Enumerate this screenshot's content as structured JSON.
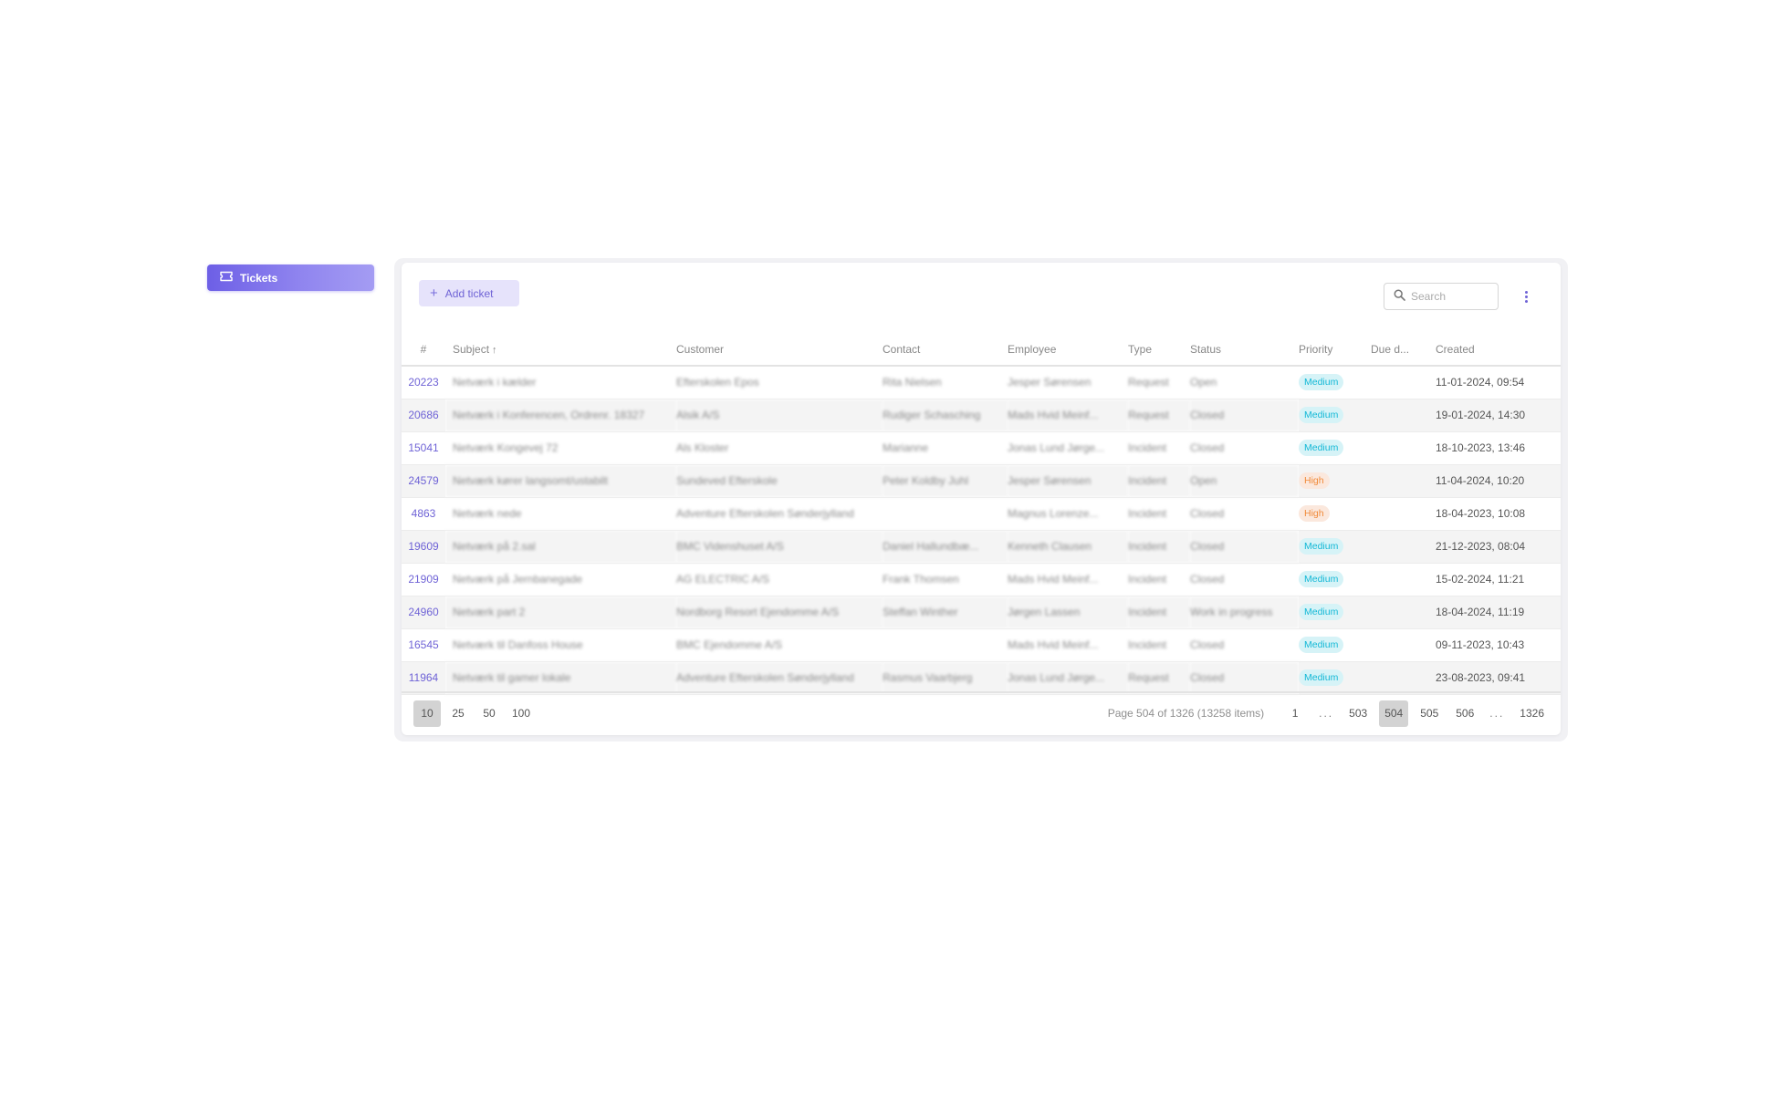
{
  "sidebar": {
    "items": [
      {
        "label": "Tickets",
        "icon": "ticket-icon",
        "active": true
      }
    ]
  },
  "toolbar": {
    "add_label": "Add ticket",
    "search_placeholder": "Search",
    "search_value": ""
  },
  "colors": {
    "accent": "#6f63d6",
    "medium_badge_bg": "#d6f3f7",
    "medium_badge_text": "#13b8d6",
    "high_badge_bg": "#fbe8dd",
    "high_badge_text": "#f08a3a"
  },
  "table": {
    "columns": [
      "#",
      "Subject",
      "Customer",
      "Contact",
      "Employee",
      "Type",
      "Status",
      "Priority",
      "Due d...",
      "Created"
    ],
    "sort": {
      "column": "Subject",
      "direction": "ascending"
    },
    "rows": [
      {
        "id": "20223",
        "subject": "Netværk i kælder",
        "customer": "Efterskolen Epos",
        "contact": "Rita Nielsen",
        "employee": "Jesper Sørensen",
        "type": "Request",
        "status": "Open",
        "priority": "Medium",
        "due": "",
        "created": "11-01-2024, 09:54"
      },
      {
        "id": "20686",
        "subject": "Netværk i Konferencen, Ordrenr. 18327",
        "customer": "Alsik A/S",
        "contact": "Rudiger Schasching",
        "employee": "Mads Hvid Meinf...",
        "type": "Request",
        "status": "Closed",
        "priority": "Medium",
        "due": "",
        "created": "19-01-2024, 14:30"
      },
      {
        "id": "15041",
        "subject": "Netværk Kongevej 72",
        "customer": "Als Kloster",
        "contact": "Marianne",
        "employee": "Jonas Lund Jørge...",
        "type": "Incident",
        "status": "Closed",
        "priority": "Medium",
        "due": "",
        "created": "18-10-2023, 13:46"
      },
      {
        "id": "24579",
        "subject": "Netværk kører langsomt/ustabilt",
        "customer": "Sundeved Efterskole",
        "contact": "Peter Koldby Juhl",
        "employee": "Jesper Sørensen",
        "type": "Incident",
        "status": "Open",
        "priority": "High",
        "due": "",
        "created": "11-04-2024, 10:20"
      },
      {
        "id": "4863",
        "subject": "Netværk nede",
        "customer": "Adventure Efterskolen Sønderjylland",
        "contact": "",
        "employee": "Magnus Lorenze...",
        "type": "Incident",
        "status": "Closed",
        "priority": "High",
        "due": "",
        "created": "18-04-2023, 10:08"
      },
      {
        "id": "19609",
        "subject": "Netværk på 2.sal",
        "customer": "BMC Videnshuset A/S",
        "contact": "Daniel Hallundbæ...",
        "employee": "Kenneth Clausen",
        "type": "Incident",
        "status": "Closed",
        "priority": "Medium",
        "due": "",
        "created": "21-12-2023, 08:04"
      },
      {
        "id": "21909",
        "subject": "Netværk på Jernbanegade",
        "customer": "AG ELECTRIC A/S",
        "contact": "Frank Thomsen",
        "employee": "Mads Hvid Meinf...",
        "type": "Incident",
        "status": "Closed",
        "priority": "Medium",
        "due": "",
        "created": "15-02-2024, 11:21"
      },
      {
        "id": "24960",
        "subject": "Netværk part 2",
        "customer": "Nordborg Resort Ejendomme A/S",
        "contact": "Steffan Winther",
        "employee": "Jørgen Lassen",
        "type": "Incident",
        "status": "Work in progress",
        "priority": "Medium",
        "due": "",
        "created": "18-04-2024, 11:19"
      },
      {
        "id": "16545",
        "subject": "Netværk til Danfoss House",
        "customer": "BMC Ejendomme A/S",
        "contact": "",
        "employee": "Mads Hvid Meinf...",
        "type": "Incident",
        "status": "Closed",
        "priority": "Medium",
        "due": "",
        "created": "09-11-2023, 10:43"
      },
      {
        "id": "11964",
        "subject": "Netværk til gamer lokale",
        "customer": "Adventure Efterskolen Sønderjylland",
        "contact": "Rasmus Vaarbjerg",
        "employee": "Jonas Lund Jørge...",
        "type": "Request",
        "status": "Closed",
        "priority": "Medium",
        "due": "",
        "created": "23-08-2023, 09:41"
      }
    ]
  },
  "pagination": {
    "page_sizes": [
      "10",
      "25",
      "50",
      "100"
    ],
    "selected_page_size": "10",
    "info": "Page 504 of 1326 (13258 items)",
    "pages": [
      "1",
      "...",
      "503",
      "504",
      "505",
      "506",
      "...",
      "1326"
    ],
    "current_page": "504"
  }
}
